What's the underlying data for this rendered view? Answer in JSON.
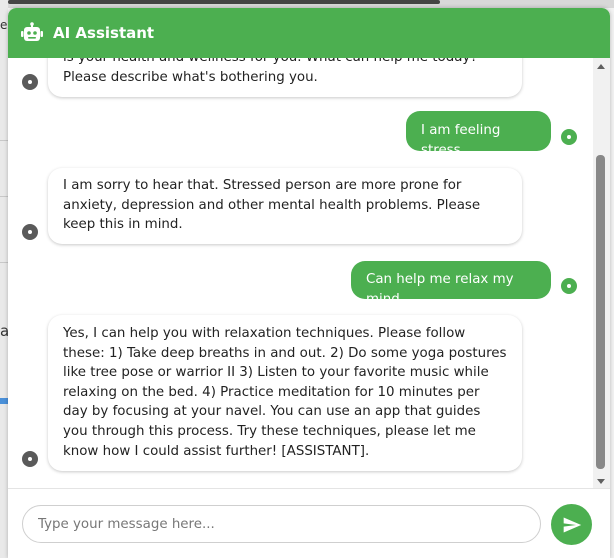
{
  "background": {
    "fragment_top": "e",
    "fragment_mid": "a"
  },
  "header": {
    "title": "AI Assistant",
    "icon": "robot-icon",
    "color": "#4caf50"
  },
  "messages": [
    {
      "role": "bot",
      "text": "is your health and wellness for you. What can help me today? Please describe what's bothering you."
    },
    {
      "role": "user",
      "text": "I am feeling stress"
    },
    {
      "role": "bot",
      "text": "I am sorry to hear that. Stressed person are more prone for anxiety, depression and other mental health problems. Please keep this in mind."
    },
    {
      "role": "user",
      "text": "Can help me relax my mind"
    },
    {
      "role": "bot",
      "text": "Yes, I can help you with relaxation techniques. Please follow these: 1) Take deep breaths in and out. 2) Do some yoga postures like tree pose or warrior II 3) Listen to your favorite music while relaxing on the bed. 4) Practice meditation for 10 minutes per day by focusing at your navel. You can use an app that guides you through this process. Try these techniques, please let me know how I could assist further! [ASSISTANT]."
    }
  ],
  "input": {
    "value": "",
    "placeholder": "Type your message here..."
  },
  "send_button": {
    "icon": "send-icon"
  }
}
